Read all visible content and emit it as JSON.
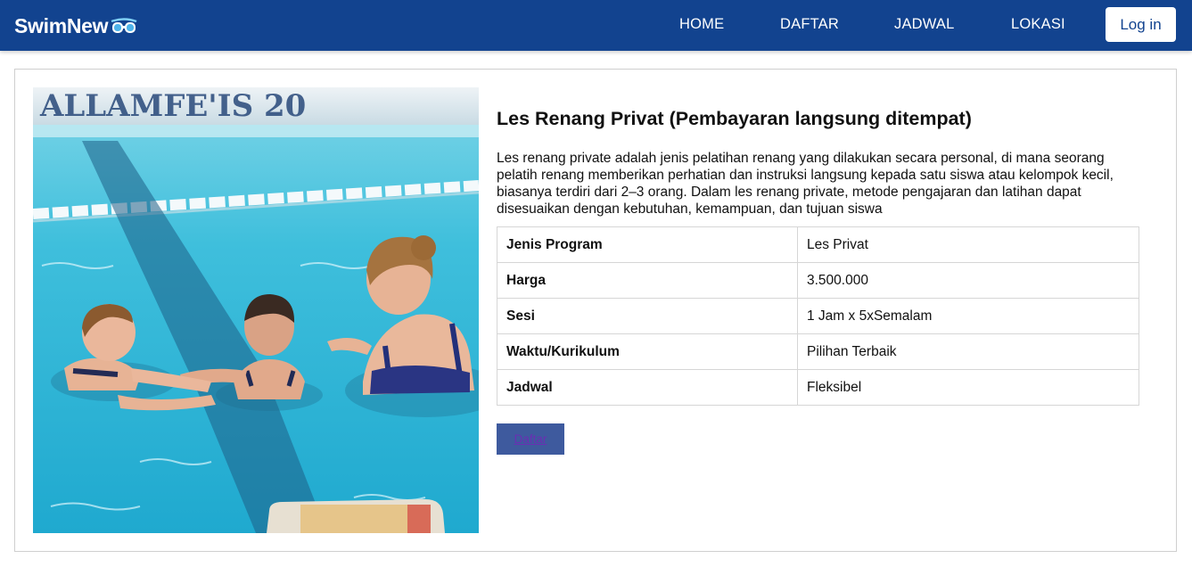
{
  "brand": {
    "name": "SwimNew",
    "icon": "goggles-icon"
  },
  "nav": {
    "links": [
      "HOME",
      "DAFTAR",
      "JADWAL",
      "LOKASI"
    ],
    "login_label": "Log in"
  },
  "colors": {
    "navbar": "#12438f",
    "button": "#3e5a9e",
    "pool_water": "#33b8d6"
  },
  "image": {
    "subject": "swimming-lesson-photo",
    "banner_text": "ALLAMFE'IS 20"
  },
  "program": {
    "title": "Les Renang Privat (Pembayaran langsung ditempat)",
    "description": "Les renang private adalah jenis pelatihan renang yang dilakukan secara personal, di mana seorang pelatih renang memberikan perhatian dan instruksi langsung kepada satu siswa atau kelompok kecil, biasanya terdiri dari 2–3 orang. Dalam les renang private, metode pengajaran dan latihan dapat disesuaikan dengan kebutuhan, kemampuan, dan tujuan siswa",
    "rows": [
      {
        "label": "Jenis Program",
        "value": "Les Privat"
      },
      {
        "label": "Harga",
        "value": "3.500.000"
      },
      {
        "label": "Sesi",
        "value": "1 Jam x 5xSemalam"
      },
      {
        "label": "Waktu/Kurikulum",
        "value": "Pilihan Terbaik"
      },
      {
        "label": "Jadwal",
        "value": "Fleksibel"
      }
    ],
    "cta_label": "Daftar"
  }
}
